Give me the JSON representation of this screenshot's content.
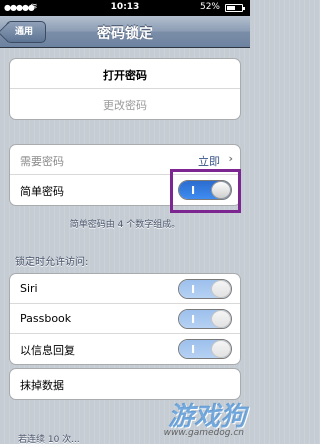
{
  "status_bar": {
    "signal": "●●●●●",
    "wifi": "≋",
    "time": "10:13",
    "battery_pct": "52%",
    "battery_level": 0.52
  },
  "nav": {
    "back_label": "通用",
    "title": "密码锁定"
  },
  "passcode_group": {
    "turn_on": "打开密码",
    "change": "更改密码"
  },
  "require_row": {
    "label": "需要密码",
    "value": "立即",
    "chevron": "›"
  },
  "simple_row": {
    "label": "简单密码",
    "switch_on_text": "I"
  },
  "simple_footnote": "简单密码由 4 个数字组成。",
  "allow_header": "锁定时允许访问:",
  "allow_items": [
    {
      "label": "Siri",
      "switch_on_text": "I"
    },
    {
      "label": "Passbook",
      "switch_on_text": "I"
    },
    {
      "label": "以信息回复",
      "switch_on_text": "I"
    }
  ],
  "erase_row": {
    "label": "抹掉数据"
  },
  "erase_footnote": "若连续 10 次...",
  "watermark": {
    "brand": "游戏狗",
    "url": "www.gamedog.cn"
  }
}
